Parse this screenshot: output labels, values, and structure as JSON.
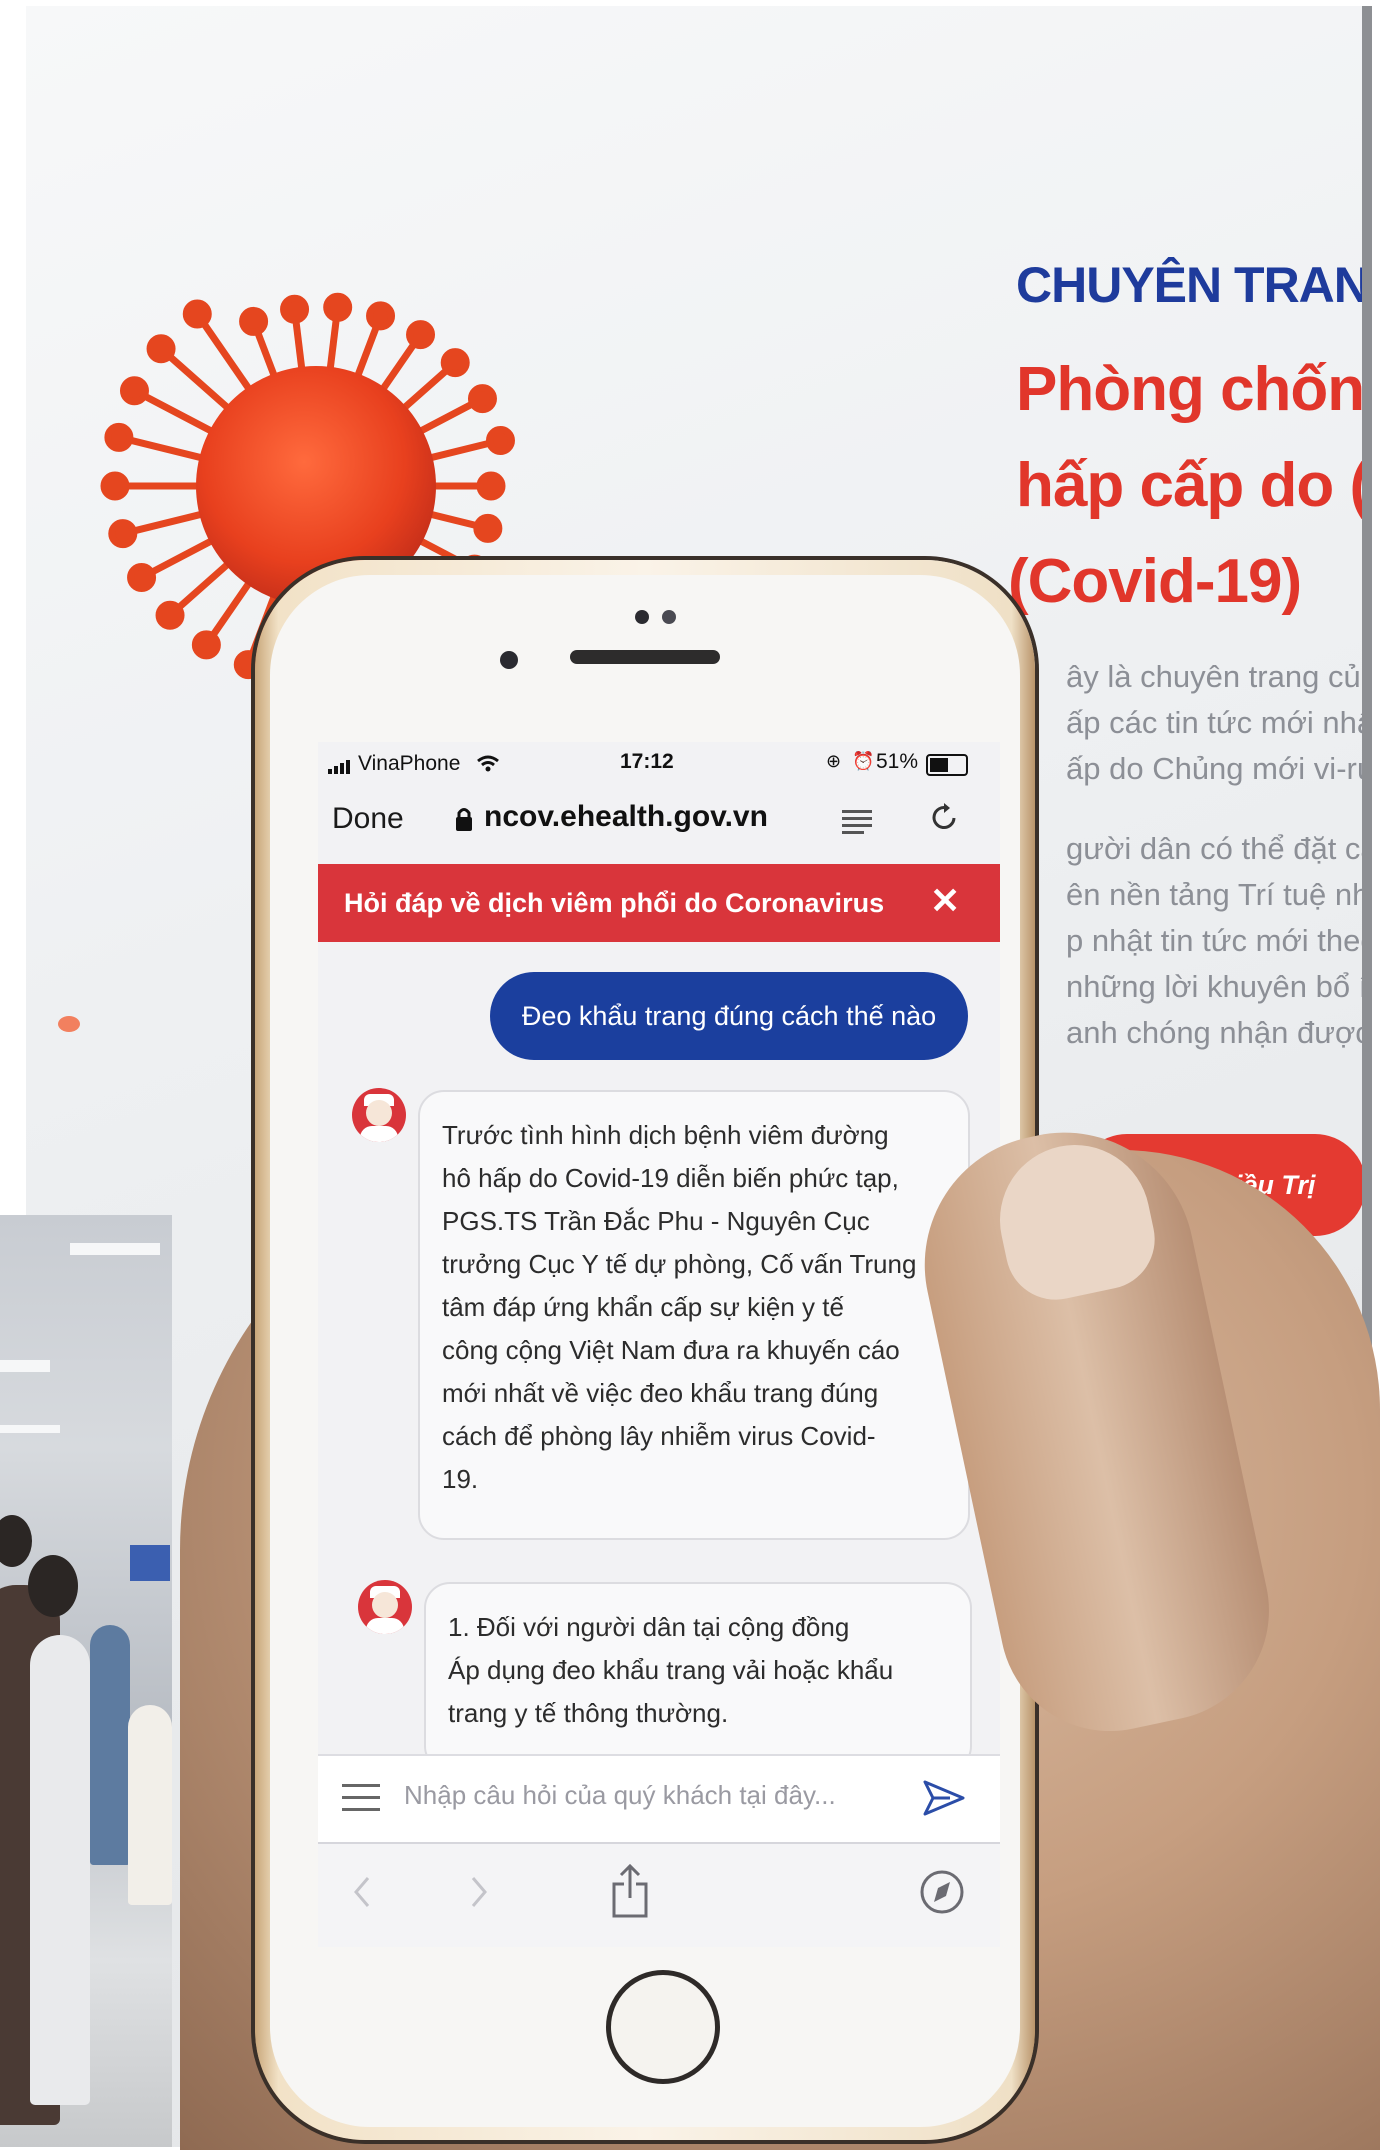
{
  "website": {
    "kicker": "CHUYÊN TRANG",
    "title_lines": [
      "Phòng chốn",
      "hấp cấp do (",
      "(Covid-19)"
    ],
    "paragraph_lines": [
      "ây là chuyên trang củ",
      "ấp các tin tức mới nhấ",
      "ấp do Chủng mới vi-rú",
      "gười dân có thể đặt cá",
      "ên nền tảng Trí tuệ nh",
      "p nhật tin tức mới theo",
      "những lời khuyên bổ í",
      "anh chóng nhận được"
    ],
    "button_label": "Cơ Sở Điều Trị",
    "accent_red": "#e1362b",
    "accent_blue": "#1e3b9c"
  },
  "phone": {
    "status_bar": {
      "carrier": "VinaPhone",
      "time": "17:12",
      "battery": "51%"
    },
    "browser": {
      "done_label": "Done",
      "url": "ncov.ehealth.gov.vn",
      "reader_icon": "reader-icon",
      "reload_icon": "reload-icon"
    },
    "chat": {
      "header_title": "Hỏi đáp về dịch viêm phổi do Coronavirus",
      "close_icon": "close-icon",
      "header_color": "#d9353b",
      "user_bubble_color": "#1b3f9e",
      "messages": [
        {
          "from": "user",
          "text": "Đeo khẩu trang đúng cách thế nào"
        },
        {
          "from": "bot",
          "lines": [
            "Trước tình hình dịch bệnh viêm đường",
            "hô hấp do Covid-19 diễn biến phức tạp,",
            "PGS.TS Trần Đắc Phu - Nguyên Cục",
            "trưởng Cục Y tế dự phòng, Cố vấn Trung",
            "tâm đáp ứng khẩn cấp sự kiện y tế",
            "công cộng Việt Nam đưa ra khuyến cáo",
            "mới nhất về việc đeo khẩu trang đúng",
            "cách để phòng lây nhiễm virus Covid-",
            "19."
          ]
        },
        {
          "from": "bot",
          "lines": [
            "1. Đối với người dân tại cộng đồng",
            "Áp dụng đeo khẩu trang vải hoặc khẩu",
            "trang y tế thông thường."
          ]
        }
      ],
      "input_placeholder": "Nhập câu hỏi của quý khách tại đây...",
      "send_icon": "send-icon",
      "menu_icon": "menu-icon"
    },
    "safari_toolbar": [
      "back-icon",
      "forward-icon",
      "share-icon",
      "compass-icon"
    ]
  }
}
